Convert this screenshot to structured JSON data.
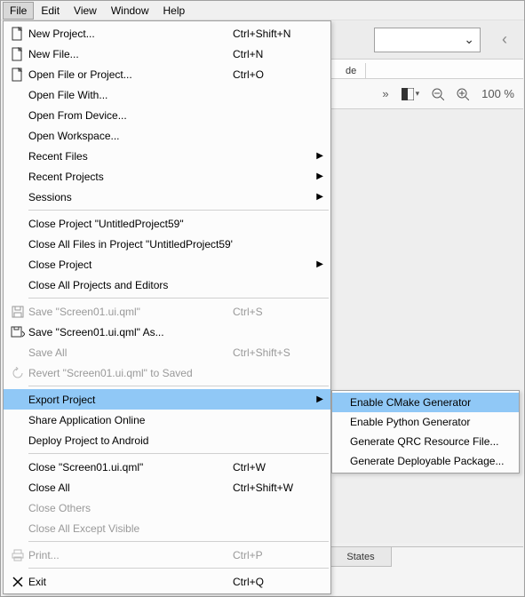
{
  "menubar": {
    "items": [
      "File",
      "Edit",
      "View",
      "Window",
      "Help"
    ]
  },
  "top_tab": {
    "label": "de"
  },
  "toolbar": {
    "zoom": "100 %"
  },
  "bottom_tab": {
    "label": "States"
  },
  "file_menu": {
    "new_project": {
      "label": "New Project...",
      "shortcut": "Ctrl+Shift+N"
    },
    "new_file": {
      "label": "New File...",
      "shortcut": "Ctrl+N"
    },
    "open_file_project": {
      "label": "Open File or Project...",
      "shortcut": "Ctrl+O"
    },
    "open_file_with": {
      "label": "Open File With..."
    },
    "open_from_device": {
      "label": "Open From Device..."
    },
    "open_workspace": {
      "label": "Open Workspace..."
    },
    "recent_files": {
      "label": "Recent Files"
    },
    "recent_projects": {
      "label": "Recent Projects"
    },
    "sessions": {
      "label": "Sessions"
    },
    "close_project_named": {
      "label": "Close Project \"UntitledProject59\""
    },
    "close_all_files_in_project": {
      "label": "Close All Files in Project \"UntitledProject59\""
    },
    "close_project": {
      "label": "Close Project"
    },
    "close_all_projects_editors": {
      "label": "Close All Projects and Editors"
    },
    "save": {
      "label": "Save \"Screen01.ui.qml\"",
      "shortcut": "Ctrl+S"
    },
    "save_as": {
      "label": "Save \"Screen01.ui.qml\" As..."
    },
    "save_all": {
      "label": "Save All",
      "shortcut": "Ctrl+Shift+S"
    },
    "revert": {
      "label": "Revert \"Screen01.ui.qml\" to Saved"
    },
    "export_project": {
      "label": "Export Project"
    },
    "share_online": {
      "label": "Share Application Online"
    },
    "deploy_android": {
      "label": "Deploy Project to Android"
    },
    "close_file": {
      "label": "Close \"Screen01.ui.qml\"",
      "shortcut": "Ctrl+W"
    },
    "close_all": {
      "label": "Close All",
      "shortcut": "Ctrl+Shift+W"
    },
    "close_others": {
      "label": "Close Others"
    },
    "close_all_except_visible": {
      "label": "Close All Except Visible"
    },
    "print": {
      "label": "Print...",
      "shortcut": "Ctrl+P"
    },
    "exit": {
      "label": "Exit",
      "shortcut": "Ctrl+Q"
    }
  },
  "export_submenu": {
    "enable_cmake": {
      "label": "Enable CMake Generator"
    },
    "enable_python": {
      "label": "Enable Python Generator"
    },
    "generate_qrc": {
      "label": "Generate QRC Resource File..."
    },
    "generate_deploy": {
      "label": "Generate Deployable Package..."
    }
  }
}
